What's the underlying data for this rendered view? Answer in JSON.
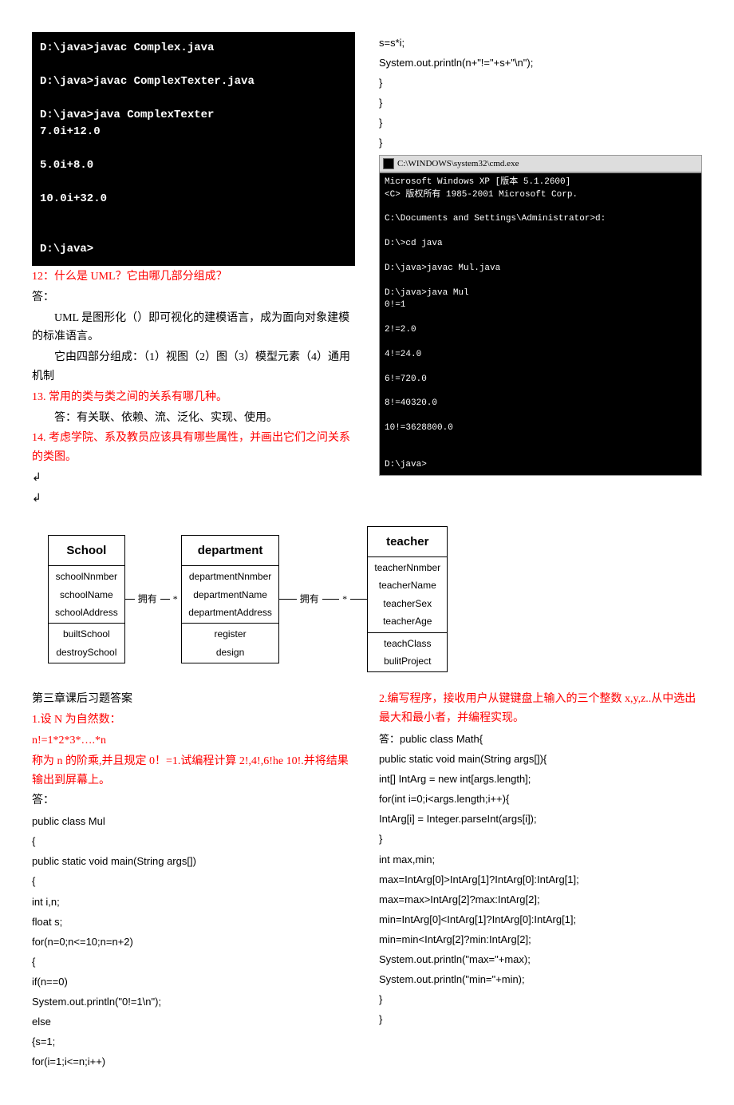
{
  "left_terminal": "D:\\java>javac Complex.java\n\nD:\\java>javac ComplexTexter.java\n\nD:\\java>java ComplexTexter\n7.0i+12.0\n\n5.0i+8.0\n\n10.0i+32.0\n\n\nD:\\java>",
  "q12_title": "12：什么是 UML？它由哪几部分组成？",
  "ans_label": "答：",
  "q12_p1": "UML 是图形化（）即可视化的建模语言，成为面向对象建模的标准语言。",
  "q12_p2": "它由四部分组成：（1）视图（2）图（3）模型元素（4）通用机制",
  "q13_title": "13.  常用的类与类之间的关系有哪几种。",
  "q13_ans": "答：有关联、依赖、流、泛化、实现、使用。",
  "q14_title": "14.  考虑学院、系及教员应该具有哪些属性，并画出它们之问关系的类图。",
  "right_code": {
    "l1": "s=s*i;",
    "l2": "System.out.println(n+\"!=\"+s+\"\\n\");",
    "l3": "}",
    "l4": "}",
    "l5": "}",
    "l6": "}"
  },
  "cmd_title": "C:\\WINDOWS\\system32\\cmd.exe",
  "right_terminal": "Microsoft Windows XP [版本 5.1.2600]\n<C> 版权所有 1985-2001 Microsoft Corp.\n\nC:\\Documents and Settings\\Administrator>d:\n\nD:\\>cd java\n\nD:\\java>javac Mul.java\n\nD:\\java>java Mul\n0!=1\n\n2!=2.0\n\n4!=24.0\n\n6!=720.0\n\n8!=40320.0\n\n10!=3628800.0\n\n\nD:\\java>",
  "uml": {
    "school": {
      "name": "School",
      "attrs": [
        "schoolNnmber",
        "schoolName",
        "schoolAddress"
      ],
      "ops": [
        "builtSchool",
        "destroySchool"
      ]
    },
    "dept": {
      "name": "department",
      "attrs": [
        "departmentNnmber",
        "departmentName",
        "departmentAddress"
      ],
      "ops": [
        "register",
        "design"
      ]
    },
    "teacher": {
      "name": "teacher",
      "attrs": [
        "teacherNnmber",
        "teacherName",
        "teacherSex",
        "teacherAge"
      ],
      "ops": [
        "teachClass",
        "bulitProject"
      ]
    },
    "conn1_label": "拥有",
    "conn1_mult": "*",
    "conn2_label": "拥有",
    "conn2_mult": "*"
  },
  "ch3_title": "第三章课后习题答案",
  "q3_1": {
    "title": "1.设 N 为自然数：",
    "l1": "n!=1*2*3*….*n",
    "l2": "称为 n 的阶乘,并且规定 0！=1.试编程计算 2!,4!,6!he 10!.并将结果输出到屏幕上。",
    "ans": "答：",
    "code": [
      "  public class Mul",
      "{",
      "public static void main(String args[])",
      "{",
      "int i,n;",
      "float s;",
      "for(n=0;n<=10;n=n+2)",
      "{",
      "if(n==0)",
      "System.out.println(\"0!=1\\n\");",
      "else",
      "{s=1;",
      "for(i=1;i<=n;i++)"
    ]
  },
  "q3_2": {
    "title": "2.编写程序，接收用户从键键盘上输入的三个整数 x,y,z..从中选出最大和最小者，并编程实现。",
    "ans_prefix": "答：",
    "code": [
      "public class Math{",
      "public static void main(String args[]){",
      "int[] IntArg = new int[args.length];",
      "for(int i=0;i<args.length;i++){",
      "            IntArg[i] = Integer.parseInt(args[i]);",
      "}",
      "int max,min;",
      "max=IntArg[0]>IntArg[1]?IntArg[0]:IntArg[1];",
      "max=max>IntArg[2]?max:IntArg[2];",
      "min=IntArg[0]<IntArg[1]?IntArg[0]:IntArg[1];",
      "min=min<IntArg[2]?min:IntArg[2];",
      "System.out.println(\"max=\"+max);",
      "System.out.println(\"min=\"+min);",
      "}",
      "}"
    ]
  }
}
